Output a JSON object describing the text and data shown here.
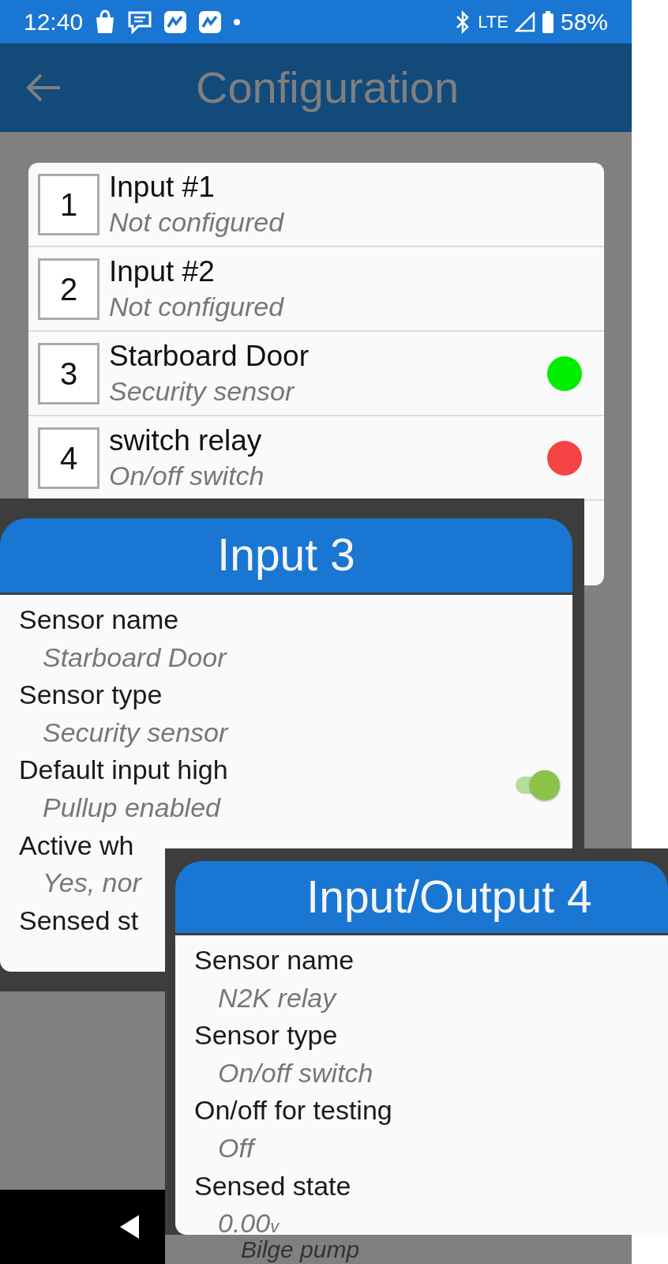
{
  "status_bar": {
    "time": "12:40",
    "network": "LTE",
    "battery": "58%"
  },
  "app_bar": {
    "title": "Configuration"
  },
  "inputs_list": {
    "items": [
      {
        "number": "1",
        "title": "Input #1",
        "subtitle": "Not configured"
      },
      {
        "number": "2",
        "title": "Input #2",
        "subtitle": "Not configured"
      },
      {
        "number": "3",
        "title": "Starboard Door",
        "subtitle": "Security sensor",
        "color": "#00ee00"
      },
      {
        "number": "4",
        "title": "switch relay",
        "subtitle": "On/off switch",
        "color": "#f44444"
      }
    ]
  },
  "dialogs": [
    {
      "title": "Input 3",
      "fields": [
        {
          "kind": "text",
          "label": "Sensor name",
          "value": "Starboard Door"
        },
        {
          "kind": "text",
          "label": "Sensor type",
          "value": "Security sensor"
        },
        {
          "kind": "toggle",
          "label": "Default input high",
          "value": "Pullup enabled",
          "on": true
        },
        {
          "kind": "text",
          "label": "Active wh",
          "value": "Yes, nor"
        },
        {
          "kind": "text",
          "label": "Sensed st"
        }
      ]
    },
    {
      "title": "Input/Output 4",
      "fields": [
        {
          "kind": "text",
          "label": "Sensor name",
          "value": "N2K relay"
        },
        {
          "kind": "text",
          "label": "Sensor type",
          "value": "On/off switch"
        },
        {
          "kind": "text",
          "label": "On/off for testing",
          "value": "Off"
        },
        {
          "kind": "text",
          "label": "Sensed state",
          "value": "0.00$_{v}$"
        }
      ]
    }
  ],
  "background_list": {
    "text": "Bilge pump"
  }
}
